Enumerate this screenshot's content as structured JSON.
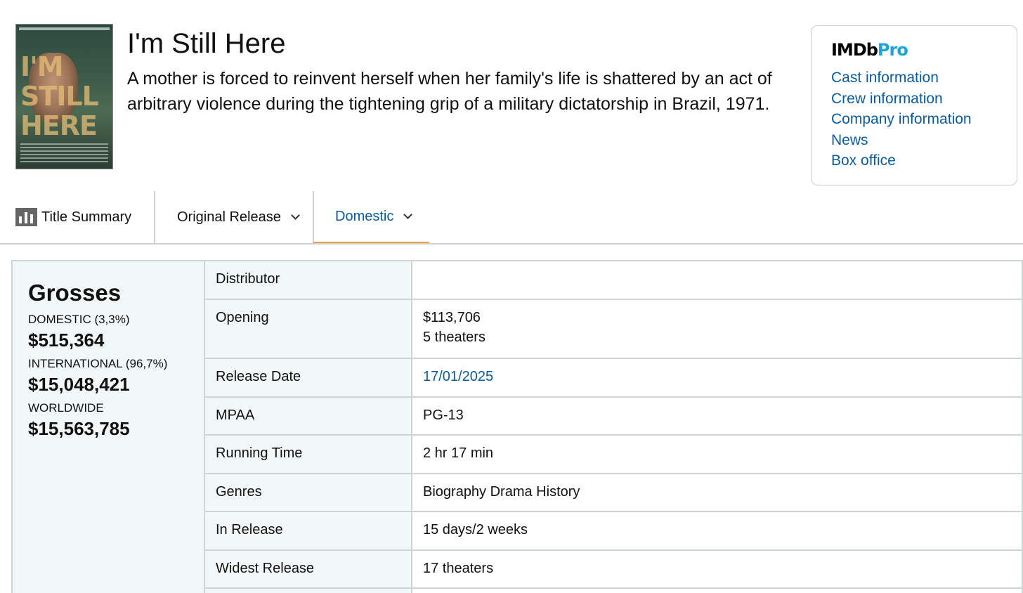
{
  "movie": {
    "title": "I'm Still Here",
    "synopsis": "A mother is forced to reinvent herself when her family's life is shattered by an act of arbitrary violence during the tightening grip of a military dictatorship in Brazil, 1971.",
    "poster_text": [
      "I'M",
      "STILL",
      "HERE"
    ]
  },
  "imdbpro": {
    "logo_imdb": "IMDb",
    "logo_pro": "Pro",
    "links": [
      "Cast information",
      "Crew information",
      "Company information",
      "News",
      "Box office"
    ]
  },
  "tabs": {
    "summary": "Title Summary",
    "original": "Original Release",
    "domestic": "Domestic"
  },
  "grosses": {
    "heading": "Grosses",
    "domestic_label": "DOMESTIC (3,3%)",
    "domestic_value": "$515,364",
    "international_label": "INTERNATIONAL (96,7%)",
    "international_value": "$15,048,421",
    "worldwide_label": "WORLDWIDE",
    "worldwide_value": "$15,563,785"
  },
  "summary": {
    "distributor_label": "Distributor",
    "distributor_value": "",
    "opening_label": "Opening",
    "opening_value": "$113,706",
    "opening_theaters": "5 theaters",
    "release_date_label": "Release Date",
    "release_date_value": "17/01/2025",
    "mpaa_label": "MPAA",
    "mpaa_value": "PG-13",
    "running_time_label": "Running Time",
    "running_time_value": "2 hr 17 min",
    "genres_label": "Genres",
    "genres_value": "Biography Drama History",
    "in_release_label": "In Release",
    "in_release_value": "15 days/2 weeks",
    "widest_release_label": "Widest Release",
    "widest_release_value": "17 theaters"
  },
  "colors": {
    "link": "#0a5b9c",
    "tab_active_underline": "#e8a33d",
    "panel_bg": "#f2f7f7",
    "pro_blue": "#1ea3d9"
  }
}
